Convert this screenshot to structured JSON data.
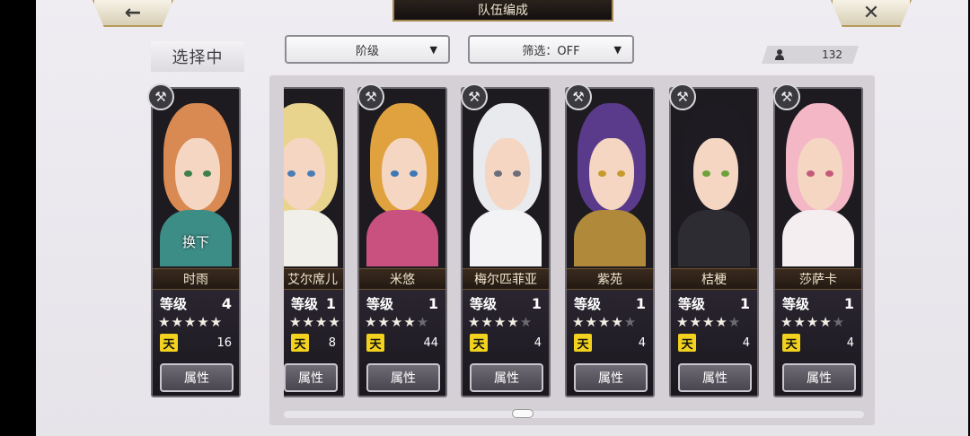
{
  "header": {
    "title": "队伍编成",
    "back_icon": "←",
    "close_icon": "✕"
  },
  "selecting_label": "选择中",
  "filters": {
    "rank_label": "阶级",
    "filter_label": "筛选：OFF",
    "arrow": "▼"
  },
  "character_count": "132",
  "selected_character": {
    "name": "时雨",
    "level_label": "等级",
    "level": "4",
    "stars": "★★★★★",
    "rank_badge": "天",
    "rank_count": "16",
    "swap_label": "换下",
    "attr_label": "属性",
    "colors": {
      "hair": "#d98a52",
      "body": "#3c8d86",
      "eye": "#3e7f4a"
    }
  },
  "characters": [
    {
      "name": "艾尔席儿",
      "level_label": "等级",
      "level": "1",
      "stars_on": "★★★★",
      "stars_off": "★",
      "rank_badge": "天",
      "rank_count": "8",
      "attr_label": "属性",
      "colors": {
        "hair": "#e9d48e",
        "body": "#f1efe9",
        "eye": "#4a7db5"
      }
    },
    {
      "name": "米悠",
      "level_label": "等级",
      "level": "1",
      "stars_on": "★★★★",
      "stars_off": "★",
      "rank_badge": "天",
      "rank_count": "44",
      "attr_label": "属性",
      "colors": {
        "hair": "#e0a23e",
        "body": "#c8517f",
        "eye": "#3b78b6"
      }
    },
    {
      "name": "梅尔匹菲亚",
      "level_label": "等级",
      "level": "1",
      "stars_on": "★★★★",
      "stars_off": "★",
      "rank_badge": "天",
      "rank_count": "4",
      "attr_label": "属性",
      "colors": {
        "hair": "#e9eaee",
        "body": "#f3f3f5",
        "eye": "#6b6e78"
      }
    },
    {
      "name": "紫苑",
      "level_label": "等级",
      "level": "1",
      "stars_on": "★★★★",
      "stars_off": "★",
      "rank_badge": "天",
      "rank_count": "4",
      "attr_label": "属性",
      "colors": {
        "hair": "#5a3a8a",
        "body": "#b08a3a",
        "eye": "#c79a2c"
      }
    },
    {
      "name": "桔梗",
      "level_label": "等级",
      "level": "1",
      "stars_on": "★★★★",
      "stars_off": "★",
      "rank_badge": "天",
      "rank_count": "4",
      "attr_label": "属性",
      "colors": {
        "hair": "#1e1c22",
        "body": "#2e2c33",
        "eye": "#6da23a"
      }
    },
    {
      "name": "莎萨卡",
      "level_label": "等级",
      "level": "1",
      "stars_on": "★★★★",
      "stars_off": "★",
      "rank_badge": "天",
      "rank_count": "4",
      "attr_label": "属性",
      "colors": {
        "hair": "#f3b7c6",
        "body": "#f4eef0",
        "eye": "#c45a7a"
      }
    }
  ],
  "icons": {
    "weapon": "weapon-axe-icon",
    "person": "person-icon",
    "back": "back-arrow-icon",
    "close": "close-icon"
  }
}
